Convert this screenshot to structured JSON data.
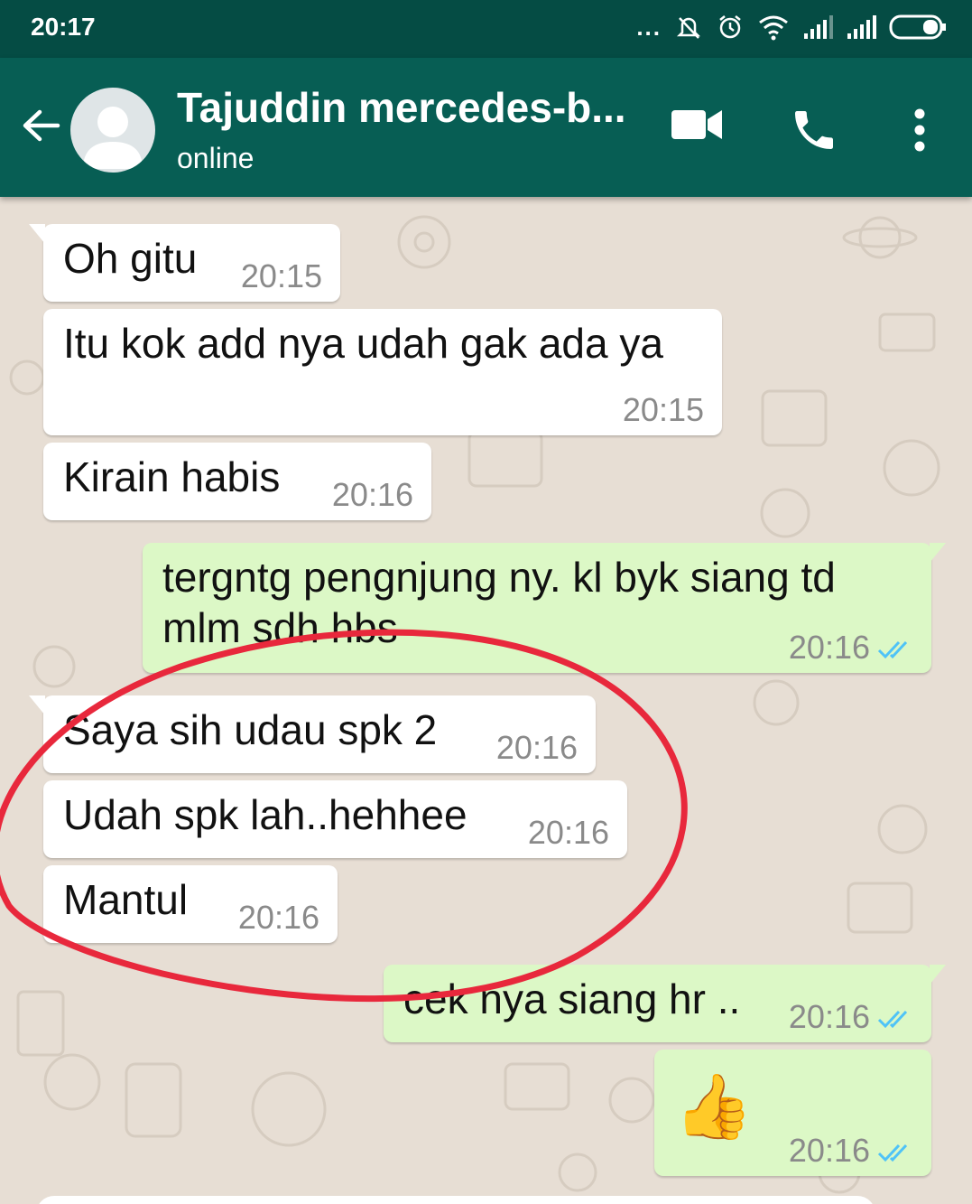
{
  "status_bar": {
    "time": "20:17",
    "more": "..."
  },
  "header": {
    "contact_name": "Tajuddin mercedes-b...",
    "status": "online"
  },
  "messages": [
    {
      "dir": "in",
      "text": "Oh gitu",
      "time": "20:15"
    },
    {
      "dir": "in",
      "text": "Itu kok add nya udah gak ada ya",
      "time": "20:15"
    },
    {
      "dir": "in",
      "text": "Kirain habis",
      "time": "20:16"
    },
    {
      "dir": "out",
      "text": "tergntg pengnjung ny. kl byk siang td mlm sdh hbs",
      "time": "20:16",
      "read": true
    },
    {
      "dir": "in",
      "text": "Saya sih udau spk 2",
      "time": "20:16"
    },
    {
      "dir": "in",
      "text": "Udah spk lah..hehhee",
      "time": "20:16"
    },
    {
      "dir": "in",
      "text": "Mantul",
      "time": "20:16"
    },
    {
      "dir": "out",
      "text": "cek nya siang hr ..",
      "time": "20:16",
      "read": true
    },
    {
      "dir": "out",
      "text": "👍",
      "time": "20:16",
      "read": true
    }
  ],
  "colors": {
    "header": "#075e54",
    "status_bar": "#054c44",
    "outgoing": "#dcf8c6",
    "incoming": "#ffffff",
    "read_ticks": "#4fc3f7",
    "annotation": "#e8283c"
  }
}
